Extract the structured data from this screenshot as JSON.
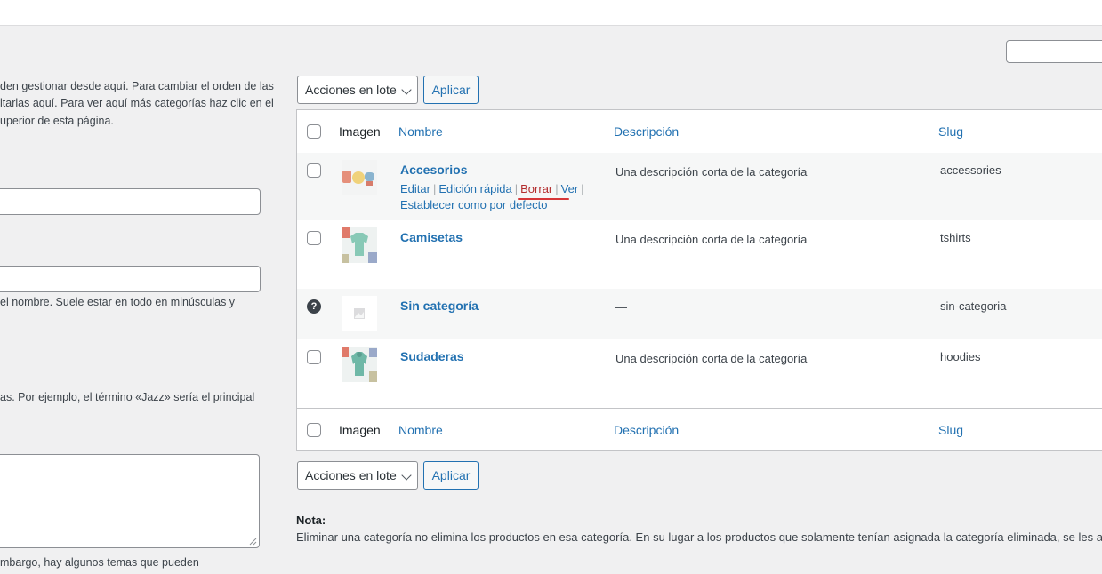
{
  "left_form": {
    "intro_lines": [
      "den gestionar desde aquí. Para cambiar el orden de las",
      "ltarlas aquí. Para ver aquí más categorías haz clic en el",
      "uperior de esta página."
    ],
    "slug_help": "el nombre. Suele estar en todo en minúsculas y",
    "parent_help": "as. Por ejemplo, el término «Jazz» sería el principal",
    "desc_help": "mbargo, hay algunos temas que pueden"
  },
  "bulk": {
    "label": "Acciones en lote",
    "apply_label": "Aplicar"
  },
  "table": {
    "columns": {
      "image": "Imagen",
      "name": "Nombre",
      "description": "Descripción",
      "slug": "Slug"
    },
    "rows": [
      {
        "name": "Accesorios",
        "description": "Una descripción corta de la categoría",
        "slug": "accessories",
        "actions": {
          "edit": "Editar",
          "quick_edit": "Edición rápida",
          "delete": "Borrar",
          "view": "Ver",
          "make_default": "Establecer como por defecto"
        }
      },
      {
        "name": "Camisetas",
        "description": "Una descripción corta de la categoría",
        "slug": "tshirts"
      },
      {
        "name": "Sin categoría",
        "description": "—",
        "slug": "sin-categoria"
      },
      {
        "name": "Sudaderas",
        "description": "Una descripción corta de la categoría",
        "slug": "hoodies"
      }
    ],
    "separator": "|"
  },
  "note": {
    "title": "Nota:",
    "text": "Eliminar una categoría no elimina los productos en esa categoría. En su lugar a los productos que solamente tenían asignada la categoría eliminada, se les asig"
  },
  "icons": {
    "help": "?"
  },
  "colors": {
    "link": "#2271b1",
    "delete": "#b32d2e",
    "highlight_underline": "#d63638"
  }
}
